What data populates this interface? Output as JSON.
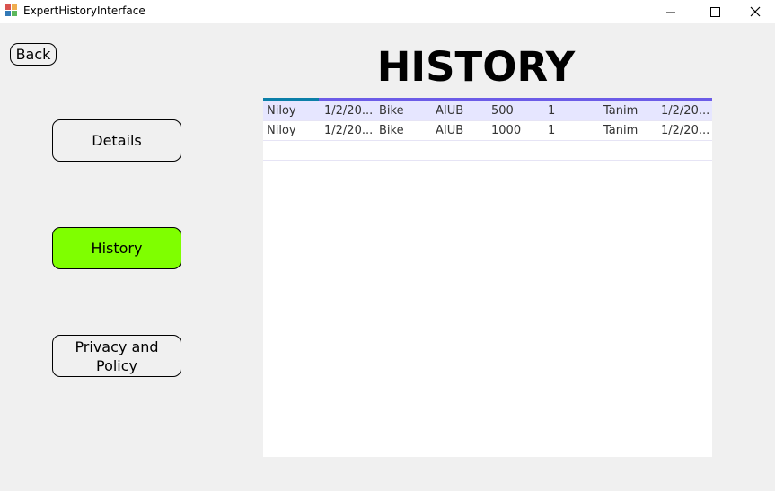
{
  "window": {
    "title": "ExpertHistoryInterface",
    "icon": "winforms-app-icon",
    "controls": {
      "minimize": "minimize-icon",
      "maximize": "maximize-icon",
      "close": "close-icon"
    }
  },
  "nav": {
    "back_label": "Back",
    "details_label": "Details",
    "history_label": "History",
    "privacy_label": "Privacy and\nPolicy",
    "active_color": "#7fff00"
  },
  "page": {
    "heading": "HISTORY"
  },
  "grid": {
    "header_color": "#6c5ce7",
    "selected_row_color": "#e6e6ff",
    "rows": [
      [
        "Niloy",
        "1/2/20...",
        "Bike",
        "AIUB",
        "500",
        "1",
        "Tanim",
        "1/2/20..."
      ],
      [
        "Niloy",
        "1/2/20...",
        "Bike",
        "AIUB",
        "1000",
        "1",
        "Tanim",
        "1/2/20..."
      ]
    ]
  }
}
